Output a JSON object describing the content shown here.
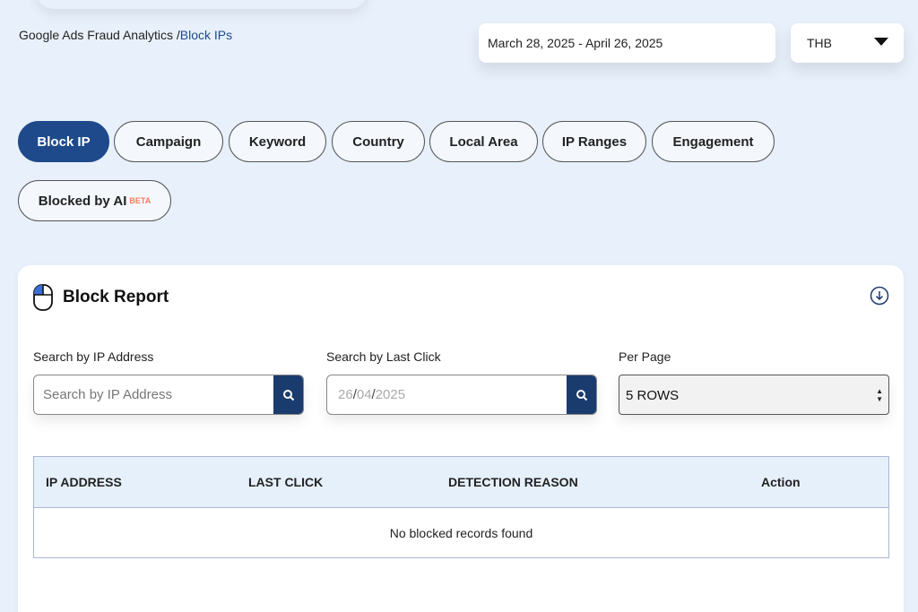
{
  "breadcrumb": {
    "parent": "Google Ads Fraud Analytics /",
    "current": "Block IPs"
  },
  "date_range": "March 28, 2025 - April 26, 2025",
  "currency": "THB",
  "tabs": [
    {
      "label": "Block IP",
      "active": true
    },
    {
      "label": "Campaign"
    },
    {
      "label": "Keyword"
    },
    {
      "label": "Country"
    },
    {
      "label": "Local Area"
    },
    {
      "label": "IP Ranges"
    },
    {
      "label": "Engagement"
    },
    {
      "label": "Blocked by AI",
      "badge": "BETA"
    }
  ],
  "report": {
    "title": "Block Report",
    "search_ip": {
      "label": "Search by IP Address",
      "placeholder": "Search by IP Address"
    },
    "search_click": {
      "label": "Search by Last Click",
      "day": "26",
      "month": "04",
      "year": "2025",
      "sep": "/"
    },
    "per_page": {
      "label": "Per Page",
      "value": "5 ROWS"
    },
    "table": {
      "columns": [
        "IP ADDRESS",
        "LAST CLICK",
        "DETECTION REASON",
        "Action"
      ],
      "empty_message": "No blocked records found"
    }
  },
  "colors": {
    "primary": "#1e4a8c",
    "page_bg": "#e8f0fb",
    "beta": "#ff7a59",
    "search_button": "#1a3b6e"
  }
}
